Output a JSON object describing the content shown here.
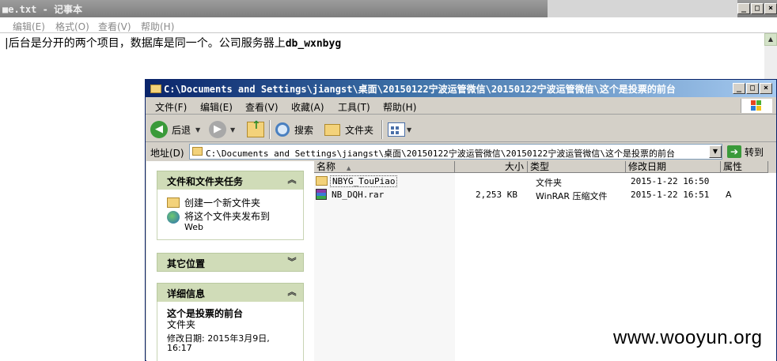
{
  "notepad": {
    "title": "■e.txt - 记事本",
    "menus": [
      "编辑(E)",
      "格式(O)",
      "查看(V)",
      "帮助(H)"
    ],
    "text_prefix": "|后台是分开的两个项目，数据库是同一个。公司服务器上",
    "text_code": "db_wxnbyg"
  },
  "explorer": {
    "title": "C:\\Documents and Settings\\jiangst\\桌面\\20150122宁波运管微信\\20150122宁波运管微信\\这个是投票的前台",
    "menus": [
      "文件(F)",
      "编辑(E)",
      "查看(V)",
      "收藏(A)",
      "工具(T)",
      "帮助(H)"
    ],
    "toolbar": {
      "back": "后退",
      "search": "搜索",
      "folders": "文件夹"
    },
    "address": {
      "label": "地址(D)",
      "path": "C:\\Documents and Settings\\jiangst\\桌面\\20150122宁波运管微信\\20150122宁波运管微信\\这个是投票的前台",
      "go": "转到"
    },
    "taskpane": {
      "file_tasks": {
        "title": "文件和文件夹任务",
        "items": [
          "创建一个新文件夹",
          "将这个文件夹发布到",
          "Web"
        ]
      },
      "other_places": {
        "title": "其它位置"
      },
      "details": {
        "title": "详细信息",
        "name": "这个是投票的前台",
        "kind": "文件夹",
        "modified_line1": "修改日期: 2015年3月9日,",
        "modified_line2": "16:17"
      }
    },
    "columns": [
      "名称",
      "大小",
      "类型",
      "修改日期",
      "属性"
    ],
    "files": [
      {
        "name": "NBYG_TouPiao",
        "size": "",
        "type": "文件夹",
        "date": "2015-1-22 16:50",
        "attr": ""
      },
      {
        "name": "NB_DQH.rar",
        "size": "2,253 KB",
        "type": "WinRAR 压缩文件",
        "date": "2015-1-22 16:51",
        "attr": "A"
      }
    ]
  },
  "watermark": "www.wooyun.org",
  "colors": {
    "xp_title_blue": "#0a246a",
    "panel_header": "#d0dcb8",
    "window_face": "#d4d0c8"
  }
}
